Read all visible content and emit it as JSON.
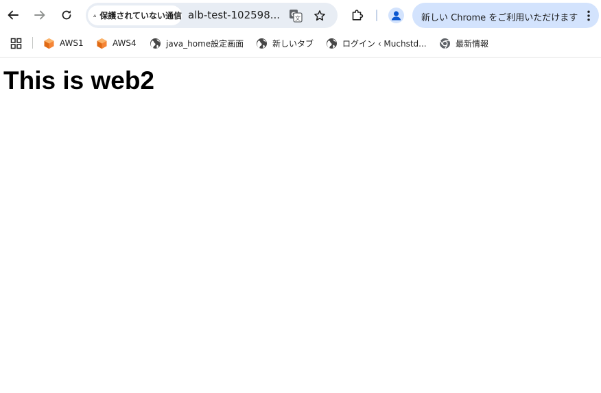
{
  "browser": {
    "security_chip": "保護されていない通信",
    "url": "alb-test-102598...",
    "promo_text": "新しい Chrome をご利用いただけます"
  },
  "bookmarks": [
    {
      "label": "AWS1",
      "icon": "aws-cube-icon"
    },
    {
      "label": "AWS4",
      "icon": "aws-cube-icon"
    },
    {
      "label": "java_home設定画面",
      "icon": "globe-icon"
    },
    {
      "label": "新しいタブ",
      "icon": "globe-icon"
    },
    {
      "label": "ログイン ‹ Muchstd...",
      "icon": "globe-icon"
    },
    {
      "label": "最新情報",
      "icon": "chrome-icon"
    }
  ],
  "page": {
    "heading": "This is web2"
  },
  "colors": {
    "omnibox_bg": "#e8edf4",
    "promo_bg": "#d3e3fd",
    "aws_orange": "#f58536",
    "profile_blue": "#0b57d0"
  }
}
